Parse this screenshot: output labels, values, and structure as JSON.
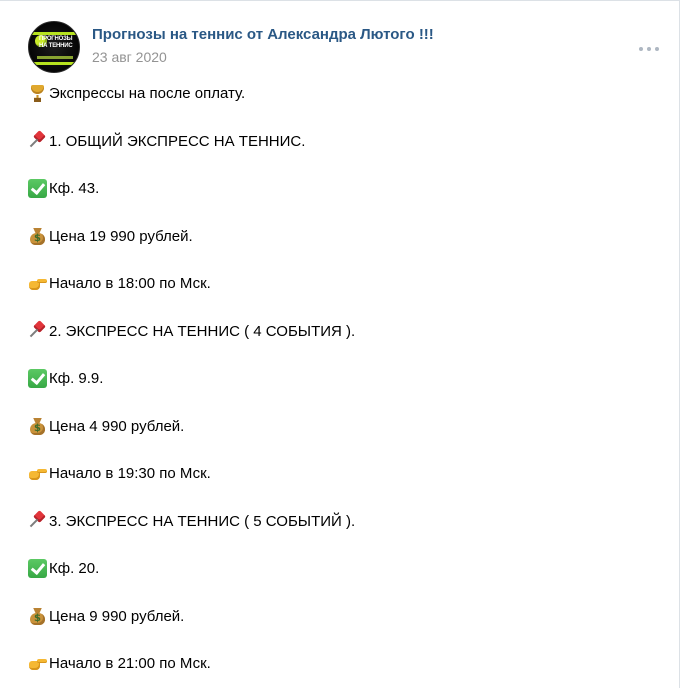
{
  "post": {
    "author": "Прогнозы на теннис от Александра Лютого !!!",
    "date": "23 авг 2020",
    "avatar_text": "Прогнозы на теннис",
    "lines": [
      {
        "icon": "trophy-icon",
        "text": "Экспрессы на после оплату."
      },
      {
        "icon": "pushpin-icon",
        "text": "1. ОБЩИЙ ЭКСПРЕСС НА ТЕННИС."
      },
      {
        "icon": "check-mark-icon",
        "text": "Кф. 43."
      },
      {
        "icon": "money-bag-icon",
        "text": "Цена 19 990 рублей."
      },
      {
        "icon": "pointing-hand-icon",
        "text": "Начало в 18:00 по Мск."
      },
      {
        "icon": "pushpin-icon",
        "text": "2. ЭКСПРЕСС НА ТЕННИС ( 4 СОБЫТИЯ )."
      },
      {
        "icon": "check-mark-icon",
        "text": "Кф. 9.9."
      },
      {
        "icon": "money-bag-icon",
        "text": "Цена 4 990 рублей."
      },
      {
        "icon": "pointing-hand-icon",
        "text": "Начало в 19:30 по Мск."
      },
      {
        "icon": "pushpin-icon",
        "text": "3. ЭКСПРЕСС НА ТЕННИС ( 5 СОБЫТИЙ )."
      },
      {
        "icon": "check-mark-icon",
        "text": "Кф. 20."
      },
      {
        "icon": "money-bag-icon",
        "text": "Цена 9 990 рублей."
      },
      {
        "icon": "pointing-hand-icon",
        "text": "Начало в 21:00 по Мск."
      }
    ]
  },
  "colors": {
    "author_link": "#2a5885",
    "date": "#939393",
    "more_dots": "#aeb7c2"
  }
}
